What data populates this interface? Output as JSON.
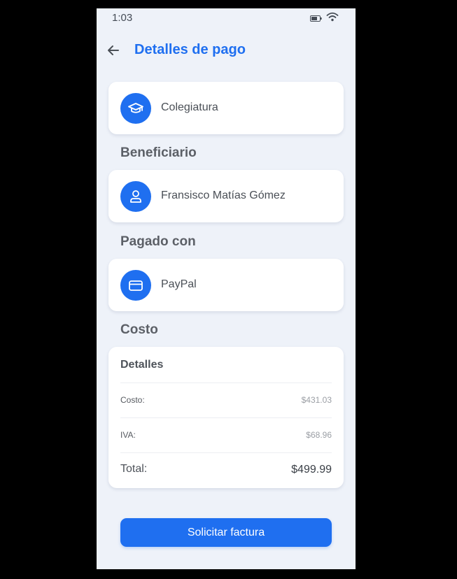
{
  "status_bar": {
    "time": "1:03",
    "battery_icon": "battery-icon",
    "wifi_icon": "wifi-icon"
  },
  "header": {
    "back_icon": "arrow-left-icon",
    "title": "Detalles de pago"
  },
  "concept": {
    "icon": "graduation-cap-icon",
    "label": "Colegiatura"
  },
  "beneficiary": {
    "section_title": "Beneficiario",
    "icon": "user-icon",
    "name": "Fransisco Matías Gómez"
  },
  "payment": {
    "section_title": "Pagado con",
    "icon": "credit-card-icon",
    "method": "PayPal"
  },
  "cost": {
    "section_title": "Costo",
    "card_title": "Detalles",
    "rows": [
      {
        "label": "Costo:",
        "value": "$431.03"
      },
      {
        "label": "IVA:",
        "value": "$68.96"
      }
    ],
    "total_label": "Total:",
    "total_value": "$499.99"
  },
  "actions": {
    "request_invoice": "Solicitar factura"
  },
  "colors": {
    "accent": "#1f6ff0",
    "background": "#eef2f9",
    "card": "#ffffff"
  }
}
